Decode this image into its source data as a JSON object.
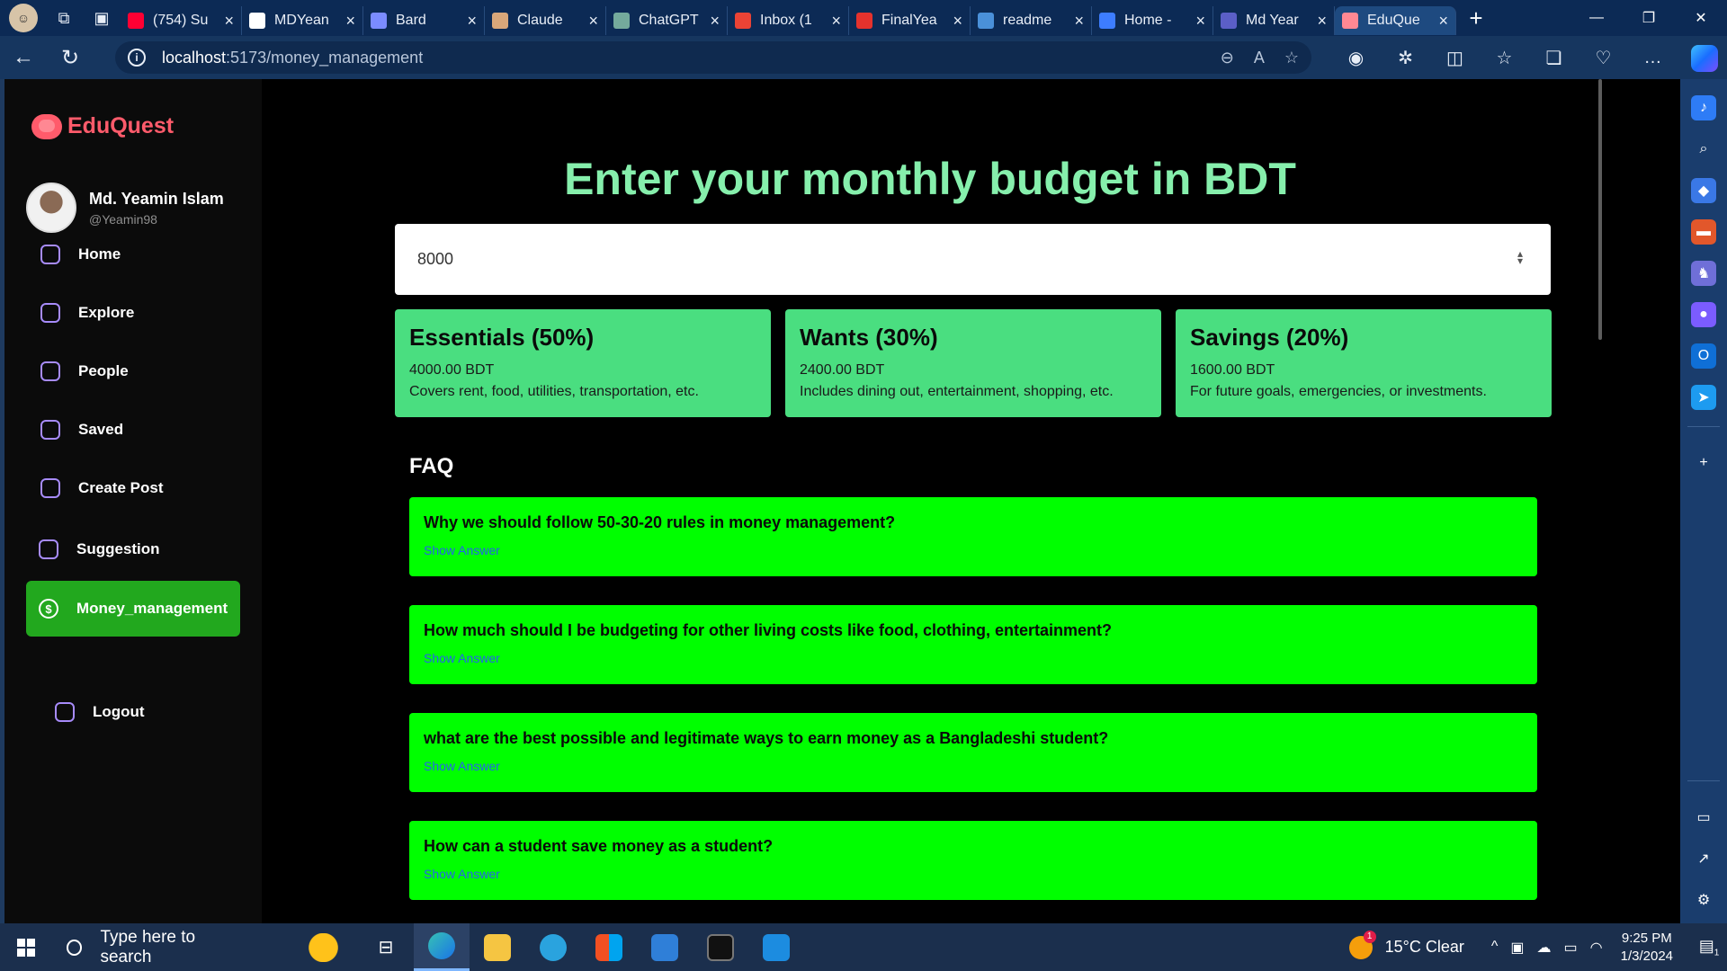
{
  "browser": {
    "tabs": [
      {
        "label": "(754) Su",
        "color": "#ff0033"
      },
      {
        "label": "MDYean",
        "color": "#ffffff"
      },
      {
        "label": "Bard",
        "color": "#7b8cff"
      },
      {
        "label": "Claude",
        "color": "#d9a77a"
      },
      {
        "label": "ChatGPT",
        "color": "#74aa9c"
      },
      {
        "label": "Inbox (1",
        "color": "#ea4335"
      },
      {
        "label": "FinalYea",
        "color": "#e5322d"
      },
      {
        "label": "readme",
        "color": "#4a90d9"
      },
      {
        "label": "Home -",
        "color": "#3d7dff"
      },
      {
        "label": "Md Year",
        "color": "#5b5fc7"
      },
      {
        "label": "EduQue",
        "color": "#ff8893"
      }
    ],
    "active_tab_index": 10,
    "url_host": "localhost",
    "url_path": ":5173/money_management"
  },
  "app": {
    "brand": "EduQuest",
    "user": {
      "name": "Md. Yeamin Islam",
      "handle": "@Yeamin98"
    },
    "nav": [
      {
        "label": "Home",
        "icon": "home-icon"
      },
      {
        "label": "Explore",
        "icon": "explore-icon"
      },
      {
        "label": "People",
        "icon": "people-icon"
      },
      {
        "label": "Saved",
        "icon": "bookmark-icon"
      },
      {
        "label": "Create Post",
        "icon": "create-post-icon"
      },
      {
        "label": "Suggestion",
        "icon": "sparkle-icon"
      },
      {
        "label": "Money_management",
        "icon": "money-icon"
      }
    ],
    "active_nav": "Money_management",
    "logout": "Logout"
  },
  "main": {
    "heading": "Enter your monthly budget in BDT",
    "budget_value": "8000",
    "cards": [
      {
        "title": "Essentials (50%)",
        "amount": "4000.00 BDT",
        "desc": "Covers rent, food, utilities, transportation, etc."
      },
      {
        "title": "Wants (30%)",
        "amount": "2400.00 BDT",
        "desc": "Includes dining out, entertainment, shopping, etc."
      },
      {
        "title": "Savings (20%)",
        "amount": "1600.00 BDT",
        "desc": "For future goals, emergencies, or investments."
      }
    ],
    "faq_title": "FAQ",
    "faq": [
      {
        "question": "Why we should follow 50-30-20 rules in money management?",
        "action": "Show Answer"
      },
      {
        "question": "How much should I be budgeting for other living costs like food, clothing, entertainment?",
        "action": "Show Answer"
      },
      {
        "question": "what are the best possible and legitimate ways to earn money as a Bangladeshi student?",
        "action": "Show Answer"
      },
      {
        "question": "How can a student save money as a student?",
        "action": "Show Answer"
      }
    ]
  },
  "taskbar": {
    "search_placeholder": "Type here to search",
    "weather": "15°C  Clear",
    "weather_badge": "1",
    "time": "9:25 PM",
    "date": "1/3/2024",
    "notification_count": "1"
  }
}
